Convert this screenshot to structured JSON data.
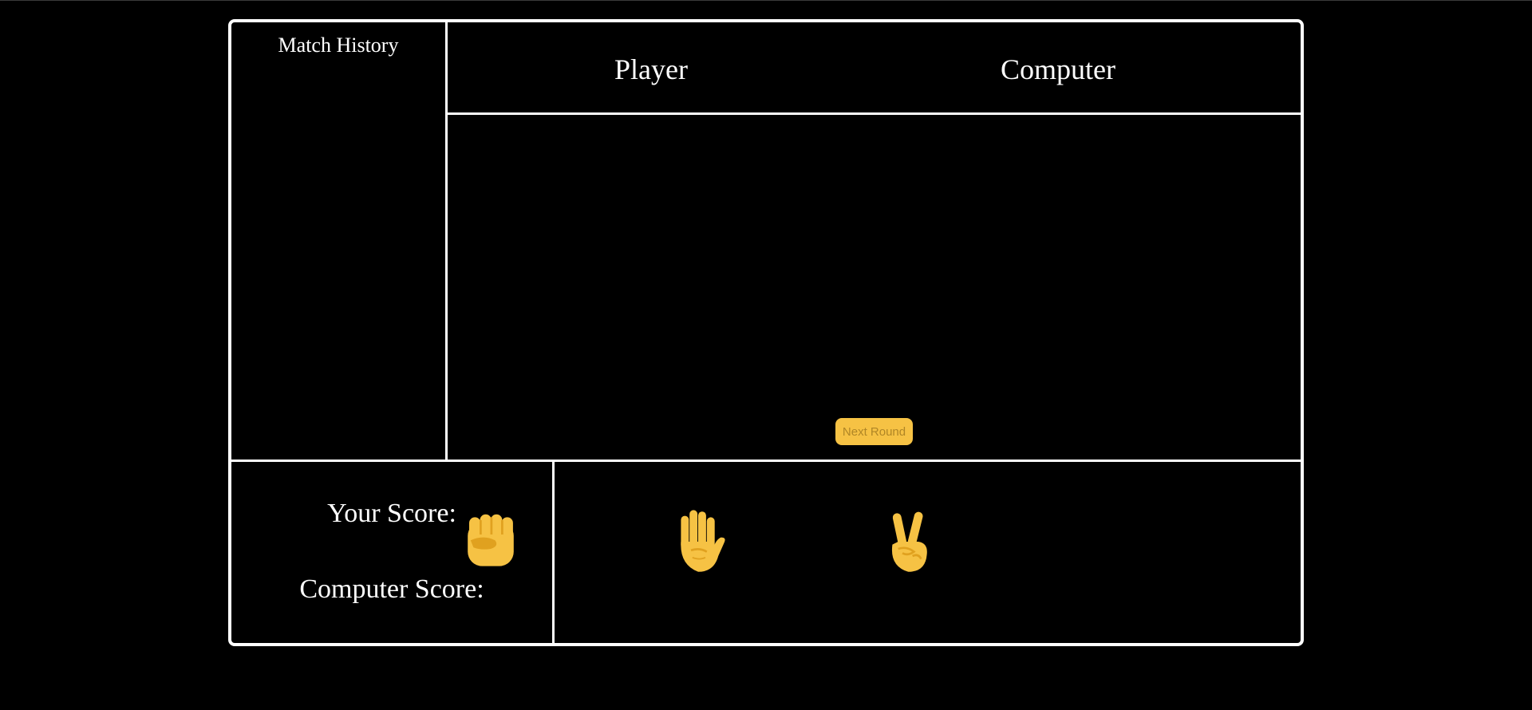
{
  "history": {
    "title": "Match History"
  },
  "arena": {
    "player_label": "Player",
    "computer_label": "Computer",
    "next_round_label": "Next Round"
  },
  "scores": {
    "your_score_label": "Your Score:",
    "computer_score_label": "Computer Score:"
  },
  "choices": [
    {
      "name": "rock",
      "icon": "raised-fist-icon"
    },
    {
      "name": "paper",
      "icon": "raised-hand-icon"
    },
    {
      "name": "scissors",
      "icon": "victory-hand-icon"
    }
  ],
  "colors": {
    "background": "#000000",
    "border": "#ffffff",
    "accent": "#f6c244",
    "button_text": "#b08626"
  }
}
